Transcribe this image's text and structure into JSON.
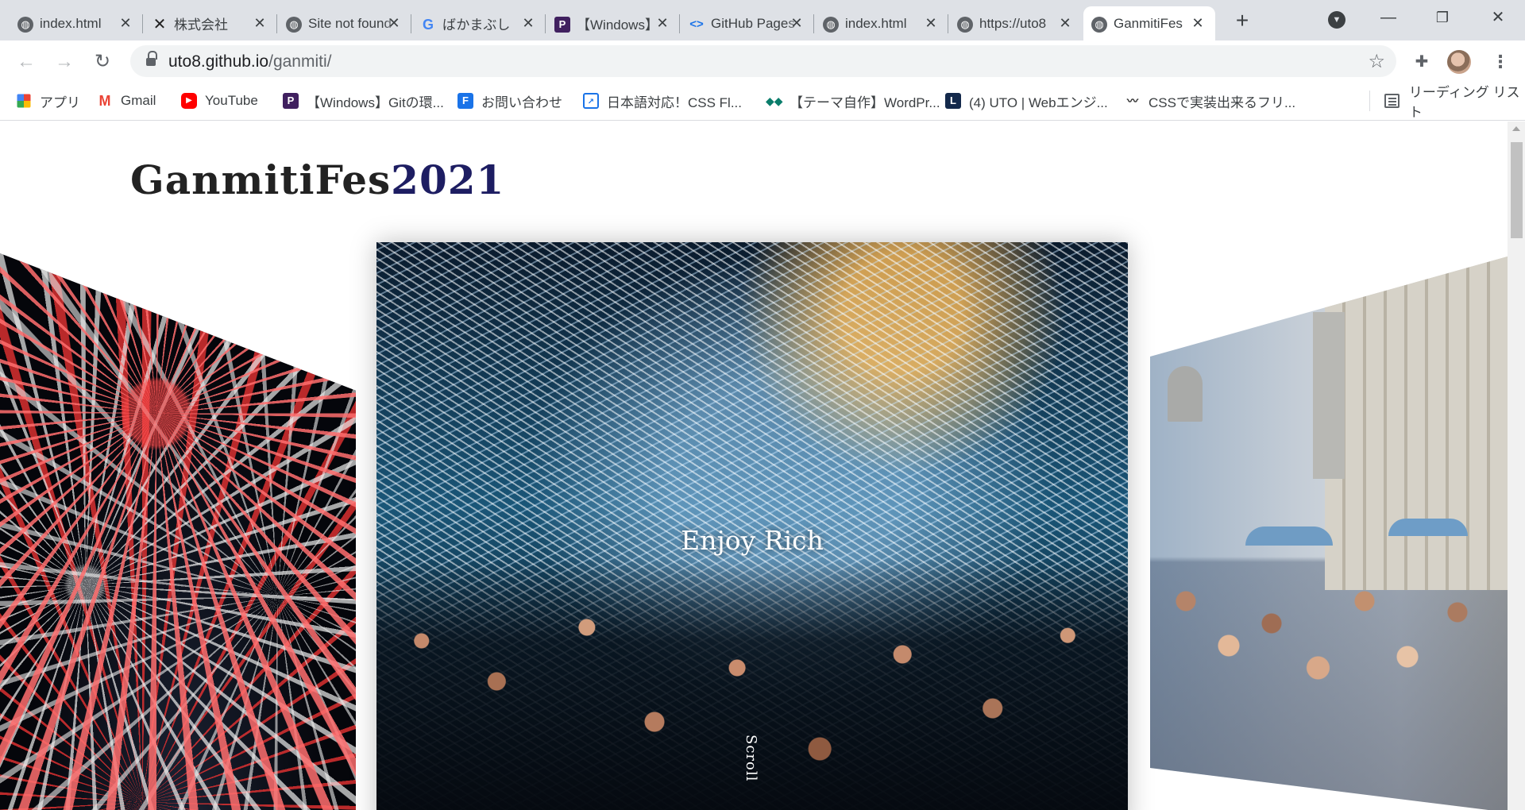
{
  "tabs": [
    {
      "title": "index.html",
      "favicon": "globe-icon",
      "active": false
    },
    {
      "title": "株式会社",
      "favicon": "x-logo-icon",
      "active": false
    },
    {
      "title": "Site not found",
      "favicon": "globe-icon",
      "active": false
    },
    {
      "title": "ばかまぶし",
      "favicon": "google-icon",
      "active": false
    },
    {
      "title": "【Windows】",
      "favicon": "p-logo-icon",
      "active": false
    },
    {
      "title": "GitHub Pages",
      "favicon": "code-icon",
      "active": false
    },
    {
      "title": "index.html",
      "favicon": "globe-icon",
      "active": false
    },
    {
      "title": "https://uto8",
      "favicon": "globe-icon",
      "active": false
    },
    {
      "title": "GanmitiFes",
      "favicon": "globe-icon",
      "active": true
    }
  ],
  "toolbar": {
    "url_host": "uto8.github.io",
    "url_path": "/ganmiti/"
  },
  "bookmarks": [
    {
      "label": "アプリ",
      "icon": "apps-grid-icon"
    },
    {
      "label": "Gmail",
      "icon": "gmail-icon"
    },
    {
      "label": "YouTube",
      "icon": "youtube-icon"
    },
    {
      "label": "【Windows】Gitの環...",
      "icon": "p-logo-icon"
    },
    {
      "label": "お問い合わせ",
      "icon": "f-logo-icon"
    },
    {
      "label": "日本語対応！CSS Fl...",
      "icon": "css-icon"
    },
    {
      "label": "【テーマ自作】WordPr...",
      "icon": "wp-icon"
    },
    {
      "label": "(4) UTO | Webエンジ...",
      "icon": "l-logo-icon"
    },
    {
      "label": "CSSで実装出来るフリ...",
      "icon": "wave-icon"
    }
  ],
  "reading_list": "リーディング リスト",
  "page": {
    "title_main": "GanmitiFes",
    "title_year": "2021",
    "slide_caption": "Enjoy Rich",
    "scroll_label": "Scroll"
  },
  "colors": {
    "year_accent": "#1d1d62",
    "tab_bar": "#dee1e6"
  }
}
